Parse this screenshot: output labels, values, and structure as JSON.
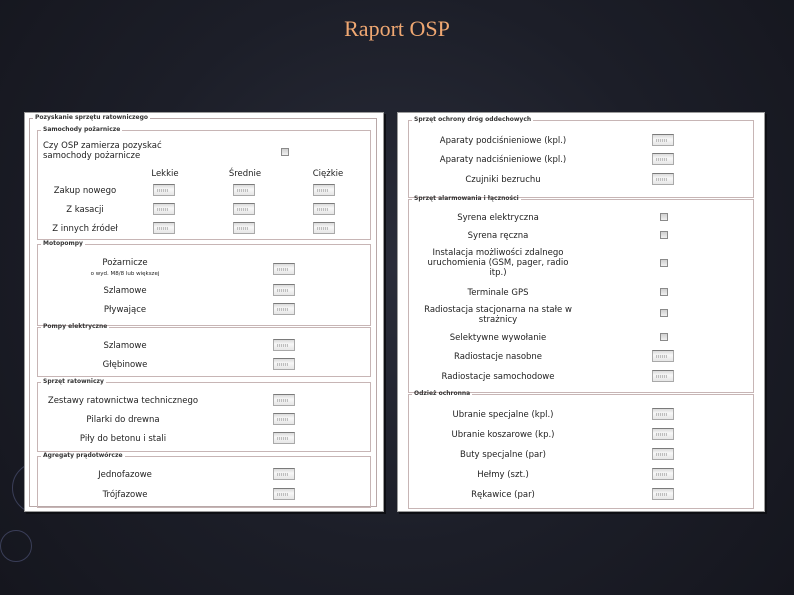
{
  "slide": {
    "title": "Raport OSP"
  },
  "left": {
    "title": "Pozyskanie sprzętu ratowniczego",
    "samochody": {
      "legend": "Samochody pożarnicze",
      "question": "Czy OSP zamierza pozyskać samochody pożarnicze",
      "col_light": "Lekkie",
      "col_medium": "Średnie",
      "col_heavy": "Ciężkie",
      "rows": [
        "Zakup nowego",
        "Z kasacji",
        "Z innych źródeł"
      ]
    },
    "motopompy": {
      "legend": "Motopompy",
      "items": [
        "Pożarnicze",
        "Szlamowe",
        "Pływające"
      ],
      "note": "o wyd. M8/8 lub większej"
    },
    "pompy": {
      "legend": "Pompy elektryczne",
      "items": [
        "Szlamowe",
        "Głębinowe"
      ]
    },
    "sprzet": {
      "legend": "Sprzęt ratowniczy",
      "items": [
        "Zestawy ratownictwa technicznego",
        "Pilarki do drewna",
        "Piły do betonu i stali"
      ]
    },
    "agregaty": {
      "legend": "Agregaty prądotwórcze",
      "items": [
        "Jednofazowe",
        "Trójfazowe"
      ]
    }
  },
  "right": {
    "drogi": {
      "legend": "Sprzęt ochrony dróg oddechowych",
      "items": [
        "Aparaty podciśnieniowe (kpl.)",
        "Aparaty nadciśnieniowe (kpl.)",
        "Czujniki bezruchu"
      ]
    },
    "alarm": {
      "legend": "Sprzęt alarmowania i łączności",
      "items": [
        "Syrena elektryczna",
        "Syrena ręczna",
        "Instalacja możliwości zdalnego uruchomienia (GSM, pager, radio itp.)",
        "Terminale GPS",
        "Radiostacja stacjonarna na stałe w strażnicy",
        "Selektywne wywołanie",
        "Radiostacje nasobne",
        "Radiostacje samochodowe"
      ]
    },
    "odziez": {
      "legend": "Odzież ochronna",
      "items": [
        "Ubranie specjalne (kpl.)",
        "Ubranie koszarowe (kp.)",
        "Buty specjalne (par)",
        "Hełmy (szt.)",
        "Rękawice (par)"
      ]
    }
  }
}
